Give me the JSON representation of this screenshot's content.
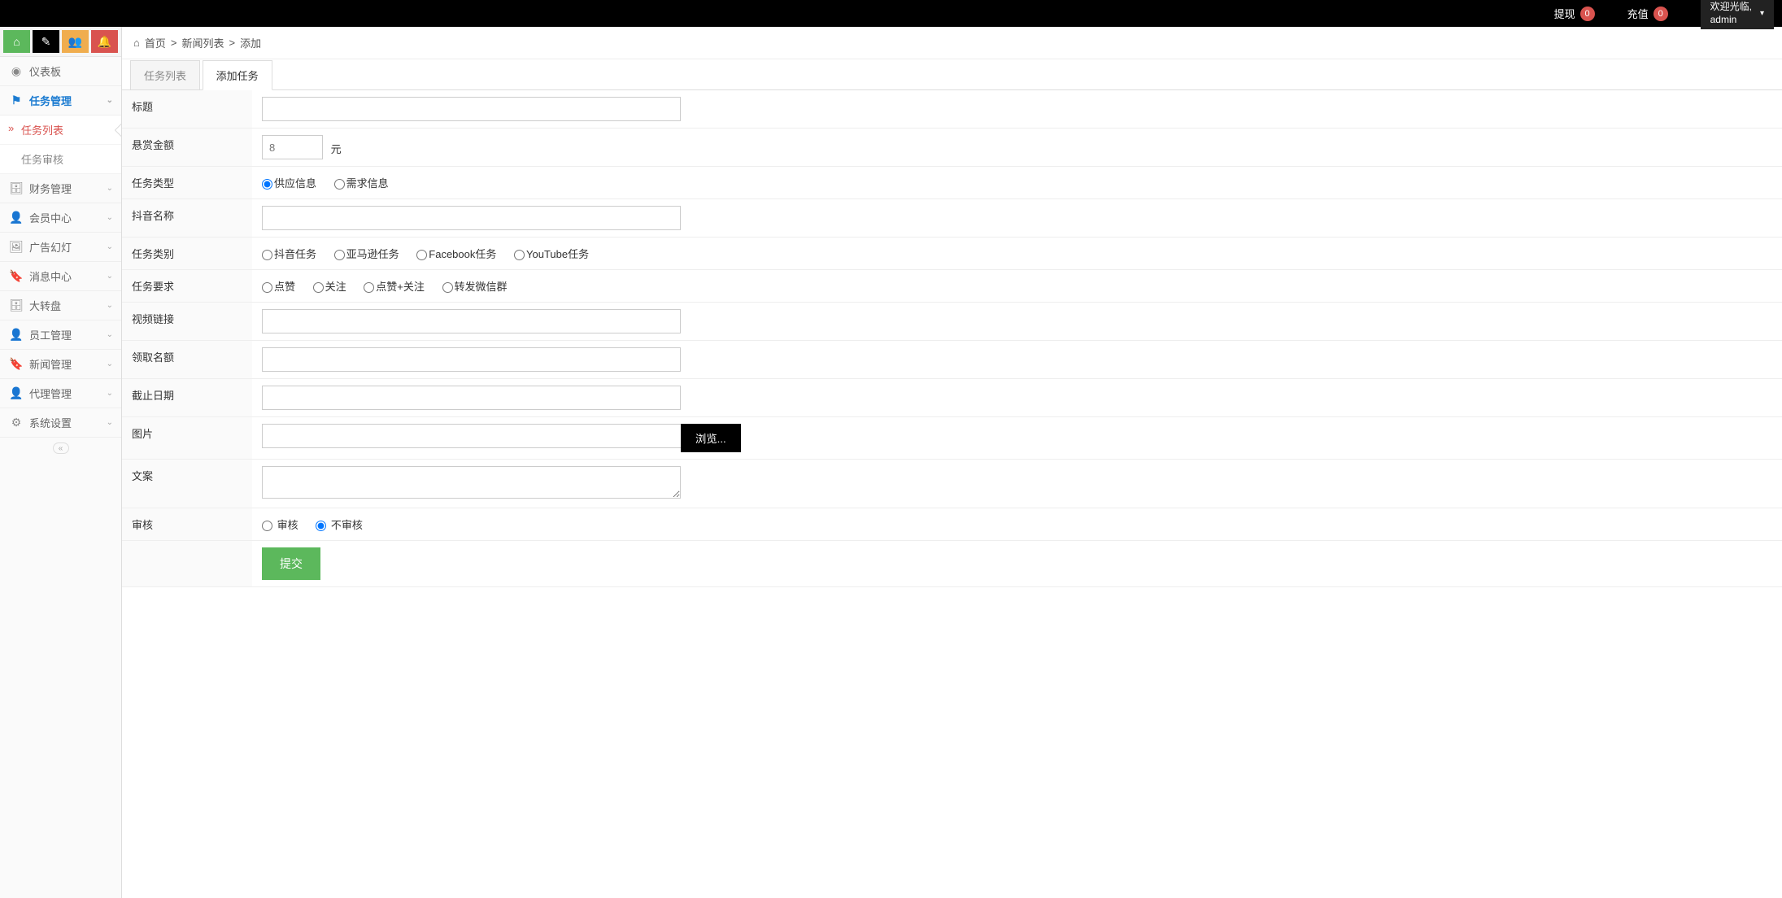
{
  "topbar": {
    "withdraw": {
      "label": "提现",
      "count": "0"
    },
    "recharge": {
      "label": "充值",
      "count": "0"
    },
    "user": {
      "greeting": "欢迎光临,",
      "name": "admin"
    }
  },
  "sidebar": {
    "dashboard": "仪表板",
    "task_mgmt": "任务管理",
    "task_list": "任务列表",
    "task_audit": "任务审核",
    "finance": "财务管理",
    "member": "会员中心",
    "ads": "广告幻灯",
    "message": "消息中心",
    "wheel": "大转盘",
    "staff": "员工管理",
    "news": "新闻管理",
    "agent": "代理管理",
    "settings": "系统设置"
  },
  "breadcrumb": {
    "home": "首页",
    "level1": "新闻列表",
    "level2": "添加"
  },
  "tabs": {
    "list": "任务列表",
    "add": "添加任务"
  },
  "form": {
    "title": {
      "label": "标题",
      "value": ""
    },
    "reward": {
      "label": "悬赏金额",
      "placeholder": "8",
      "unit": "元"
    },
    "task_type": {
      "label": "任务类型",
      "opt1": "供应信息",
      "opt2": "需求信息"
    },
    "douyin_name": {
      "label": "抖音名称",
      "value": ""
    },
    "task_category": {
      "label": "任务类别",
      "opt1": "抖音任务",
      "opt2": "亚马逊任务",
      "opt3": "Facebook任务",
      "opt4": "YouTube任务"
    },
    "task_req": {
      "label": "任务要求",
      "opt1": "点赞",
      "opt2": "关注",
      "opt3": "点赞+关注",
      "opt4": "转发微信群"
    },
    "video_link": {
      "label": "视频链接",
      "value": ""
    },
    "quota": {
      "label": "领取名额",
      "value": ""
    },
    "deadline": {
      "label": "截止日期",
      "value": ""
    },
    "image": {
      "label": "图片",
      "browse": "浏览..."
    },
    "copy": {
      "label": "文案",
      "value": ""
    },
    "audit": {
      "label": "审核",
      "opt1": "审核",
      "opt2": "不审核"
    },
    "submit": "提交"
  }
}
